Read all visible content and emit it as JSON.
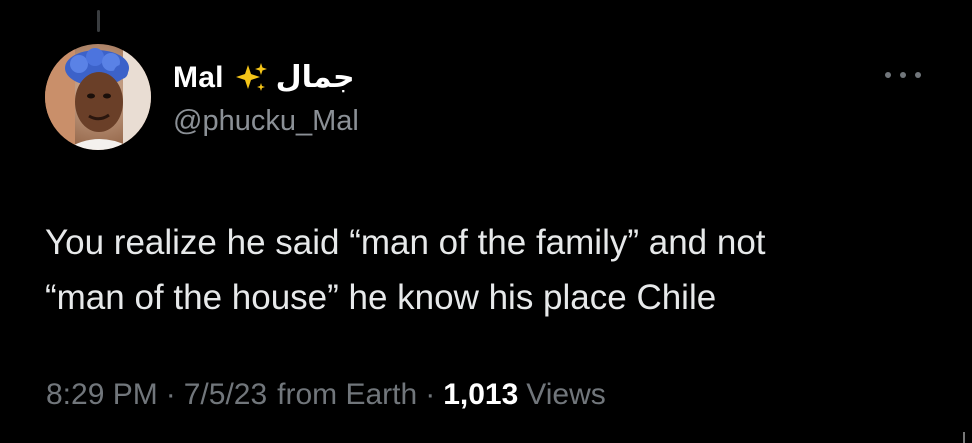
{
  "tweet": {
    "author": {
      "display_name": "Mal",
      "emoji_icon": "sparkles-icon",
      "display_name_arabic": "جمال",
      "handle": "@phucku_Mal",
      "avatar": "profile-photo"
    },
    "menu_icon": "more-horizontal-icon",
    "text_line_1": "You realize he said “man of the family” and not",
    "text_line_2": "“man of the house” he know his place Chile",
    "time": "8:29 PM",
    "separator": "·",
    "date": "7/5/23",
    "source": "from Earth",
    "views_count": "1,013",
    "views_label": "Views"
  },
  "colors": {
    "background": "#000000",
    "primary_text": "#e7e9ea",
    "secondary_text": "#71767b",
    "sparkle": "#f5c518"
  }
}
